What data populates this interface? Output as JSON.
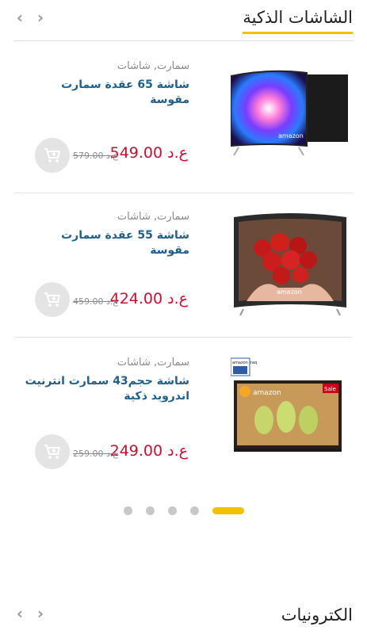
{
  "section1": {
    "title": "الشاشات الذكية",
    "prev_icon": "chevron-left-icon",
    "next_icon": "chevron-right-icon"
  },
  "products": [
    {
      "category": "سمارت, شاشات",
      "name": "شاشة 65 عقدة سمارت مقوسة",
      "price": "ع.د 549.00",
      "old_price": "ع.د 579.00",
      "brand": "amazon"
    },
    {
      "category": "سمارت, شاشات",
      "name": "شاشة 55 عقدة سمارت مقوسة",
      "price": "ع.د 424.00",
      "old_price": "ع.د 459.00",
      "brand": "amazon"
    },
    {
      "category": "سمارت, شاشات",
      "name": "شاشة حجم43 سمارت انترنيت اندرويد ذكية",
      "price": "ع.د 249.00",
      "old_price": "ع.د 259.00",
      "brand": "amazon",
      "badge": "Sale",
      "logo_text": "amazon iraq"
    }
  ],
  "carousel": {
    "page_count": 5,
    "active_index": 4
  },
  "section2": {
    "title": "الكترونيات"
  },
  "colors": {
    "accent": "#f2c200",
    "price": "#c8102e",
    "link": "#1f5f8b"
  }
}
